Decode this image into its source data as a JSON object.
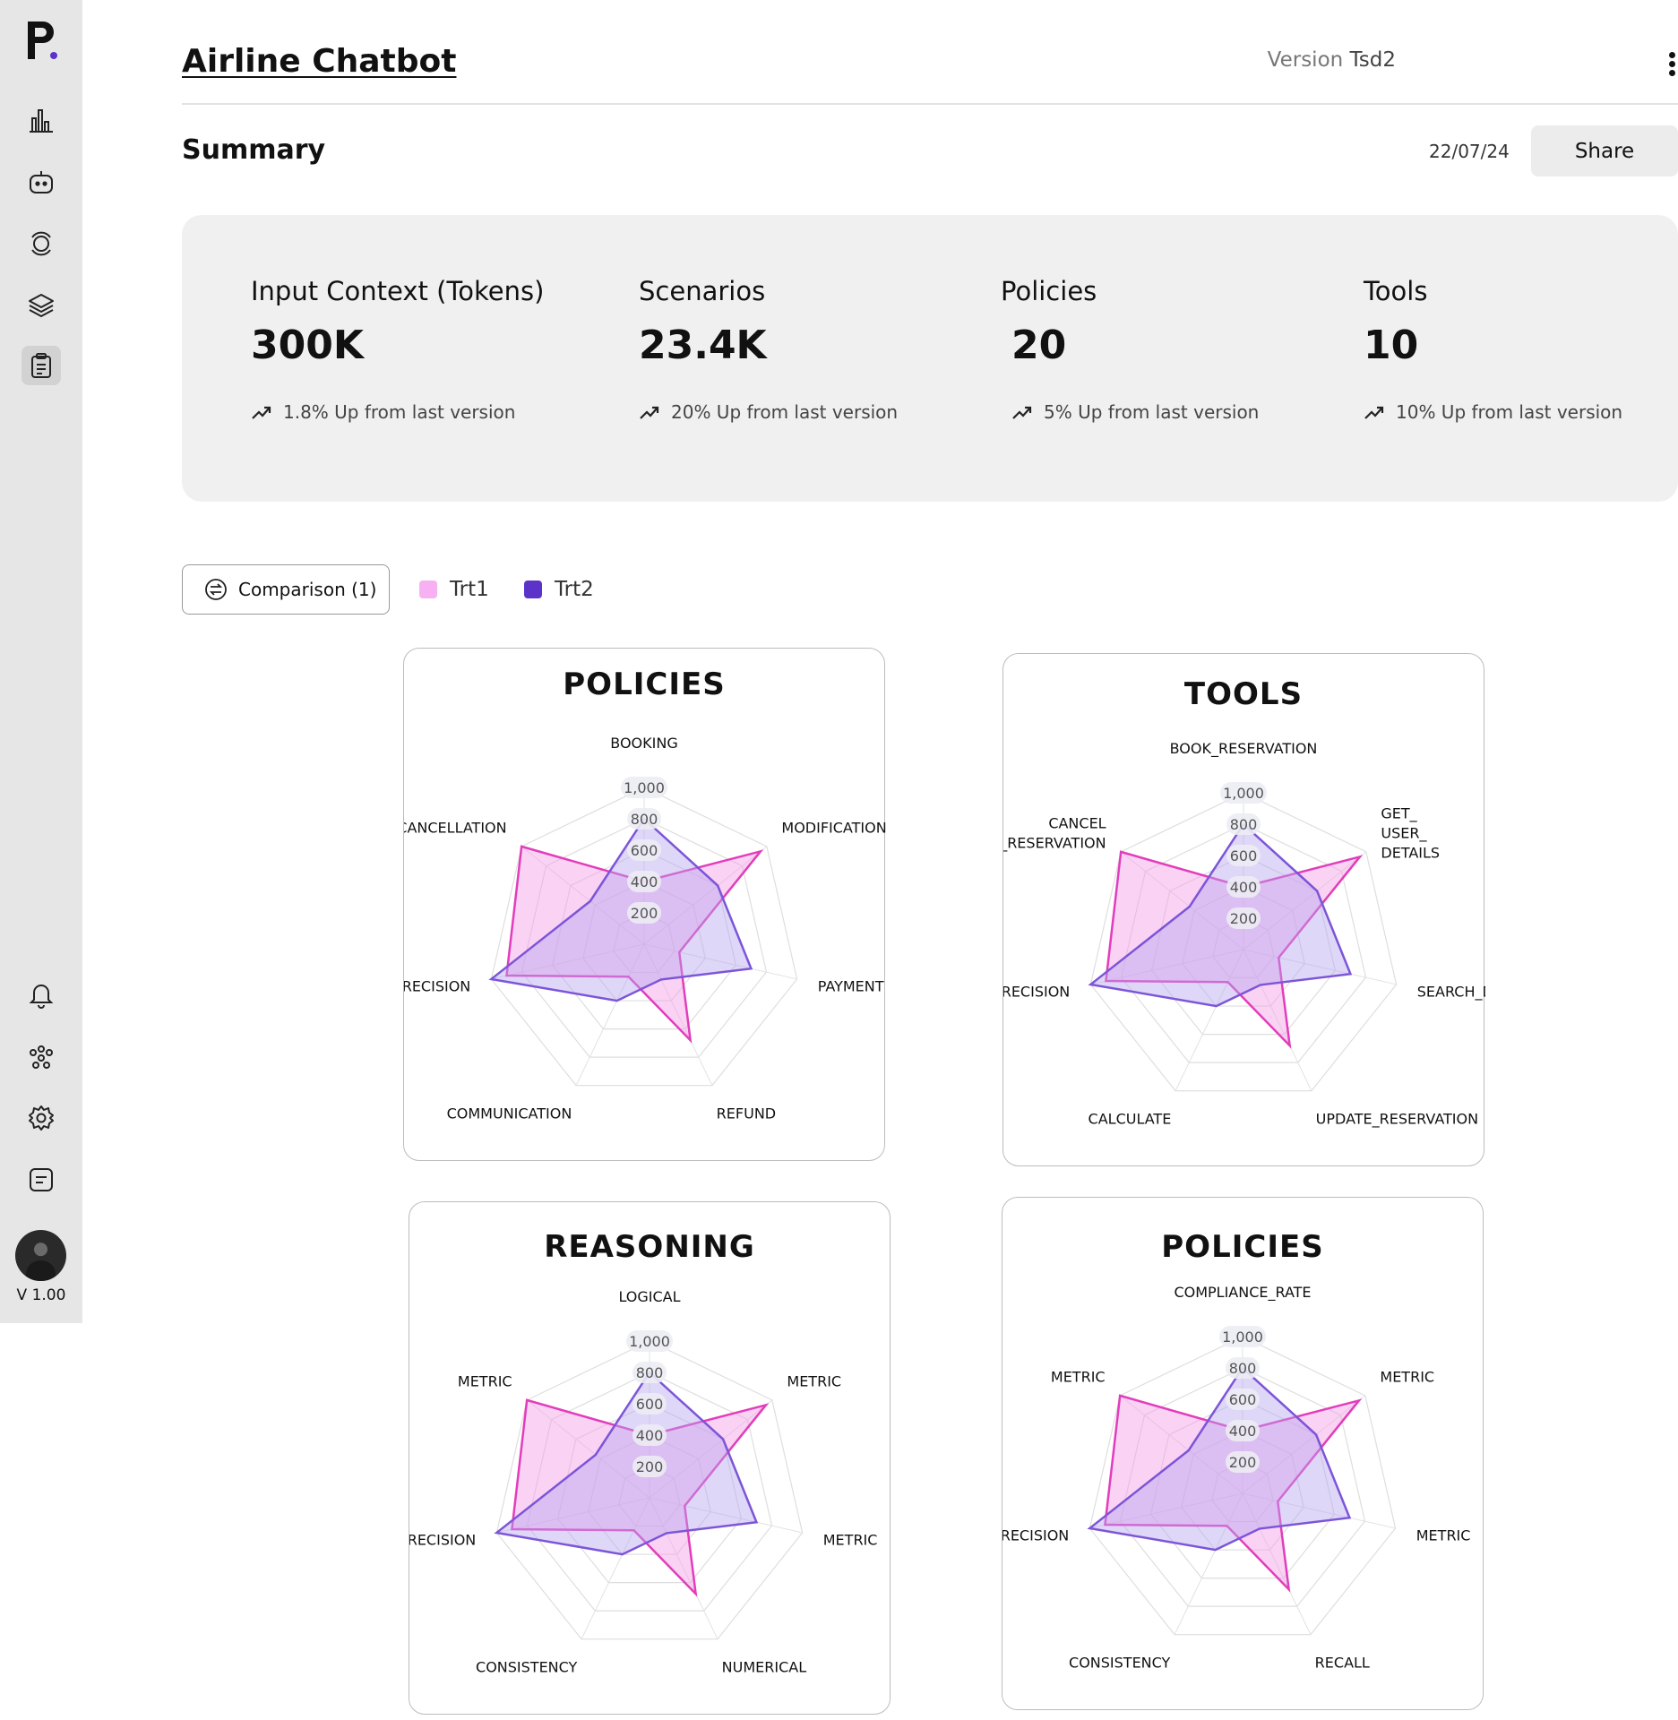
{
  "app": {
    "logo_letter": "P",
    "version_label": "V 1.00"
  },
  "sidebar": {
    "top_items": [
      {
        "name": "analytics-icon"
      },
      {
        "name": "bot-icon"
      },
      {
        "name": "monitor-icon"
      },
      {
        "name": "layers-icon"
      },
      {
        "name": "clipboard-icon",
        "active": true
      }
    ],
    "bottom_items": [
      {
        "name": "bell-icon"
      },
      {
        "name": "team-icon"
      },
      {
        "name": "settings-icon"
      },
      {
        "name": "notes-icon"
      }
    ]
  },
  "header": {
    "title": "Airline Chatbot",
    "version_prefix": "Version",
    "version_value": "Tsd2",
    "section": "Summary",
    "date": "22/07/24",
    "share_label": "Share"
  },
  "stats": [
    {
      "label": "Input Context (Tokens)",
      "value": "300K",
      "delta": "1.8% Up from last version"
    },
    {
      "label": "Scenarios",
      "value": "23.4K",
      "delta": "20% Up from last version"
    },
    {
      "label": "Policies",
      "value": "20",
      "delta": "5% Up from last version"
    },
    {
      "label": "Tools",
      "value": "10",
      "delta": "10% Up from last version"
    }
  ],
  "comparison": {
    "button_label": "Comparison (1)",
    "legend": [
      {
        "name": "Trt1",
        "color": "#f7b0f1"
      },
      {
        "name": "Trt2",
        "color": "#5b33c9"
      }
    ]
  },
  "colors": {
    "trt1_stroke": "#e23dbb",
    "trt1_fill": "#f49ee6",
    "trt2_stroke": "#7c55d8",
    "trt2_fill": "#b9a6f0"
  },
  "chart_data": [
    {
      "type": "radar",
      "title": "POLICIES",
      "categories": [
        "BOOKING",
        "MODIFICATION",
        "PAYMENT METHODS",
        "REFUND",
        "COMMUNICATION",
        "PRECISION",
        "CANCELLATION"
      ],
      "rticks": [
        "200",
        "400",
        "600",
        "800",
        "1,000"
      ],
      "rlim": [
        0,
        1000
      ],
      "series": [
        {
          "name": "Trt1",
          "values": [
            400,
            950,
            230,
            680,
            230,
            900,
            1000
          ]
        },
        {
          "name": "Trt2",
          "values": [
            800,
            600,
            700,
            250,
            400,
            1000,
            440
          ]
        }
      ]
    },
    {
      "type": "radar",
      "title": "TOOLS",
      "categories": [
        "BOOK_RESERVATION",
        "GET_\nUSER_\nDETAILS",
        "SEARCH_DIRECT_FLIGHT",
        "UPDATE_RESERVATION",
        "CALCULATE",
        "PRECISION",
        "CANCEL\n_RESERVATION"
      ],
      "label_order": [
        "BOOK_RESERVATION",
        "GET_ USER_ DETAILS",
        "SEARCH_DIRECT_FLIGHT",
        "UPDATE_RESERVATION",
        "CALCULATE",
        "CANCEL _RESERVATION"
      ],
      "rticks": [
        "200",
        "400",
        "600",
        "800",
        "1,000"
      ],
      "rlim": [
        0,
        1000
      ],
      "series": [
        {
          "name": "Trt1",
          "values": [
            400,
            950,
            230,
            680,
            230,
            900,
            1000
          ]
        },
        {
          "name": "Trt2",
          "values": [
            800,
            600,
            700,
            250,
            400,
            1000,
            440
          ]
        }
      ]
    },
    {
      "type": "radar",
      "title": "REASONING",
      "categories": [
        "LOGICAL",
        "METRIC",
        "METRIC",
        "NUMERICAL",
        "CONSISTENCY",
        "PRECISION",
        "METRIC"
      ],
      "rticks": [
        "200",
        "400",
        "600",
        "800",
        "1,000"
      ],
      "rlim": [
        0,
        1000
      ],
      "series": [
        {
          "name": "Trt1",
          "values": [
            400,
            950,
            230,
            680,
            230,
            900,
            1000
          ]
        },
        {
          "name": "Trt2",
          "values": [
            800,
            600,
            700,
            250,
            400,
            1000,
            440
          ]
        }
      ]
    },
    {
      "type": "radar",
      "title": "POLICIES",
      "categories": [
        "COMPLIANCE_RATE",
        "METRIC",
        "METRIC",
        "RECALL",
        "CONSISTENCY",
        "PRECISION",
        "METRIC"
      ],
      "rticks": [
        "200",
        "400",
        "600",
        "800",
        "1,000"
      ],
      "rlim": [
        0,
        1000
      ],
      "series": [
        {
          "name": "Trt1",
          "values": [
            400,
            950,
            230,
            680,
            230,
            900,
            1000
          ]
        },
        {
          "name": "Trt2",
          "values": [
            800,
            600,
            700,
            250,
            400,
            1000,
            440
          ]
        }
      ]
    }
  ]
}
